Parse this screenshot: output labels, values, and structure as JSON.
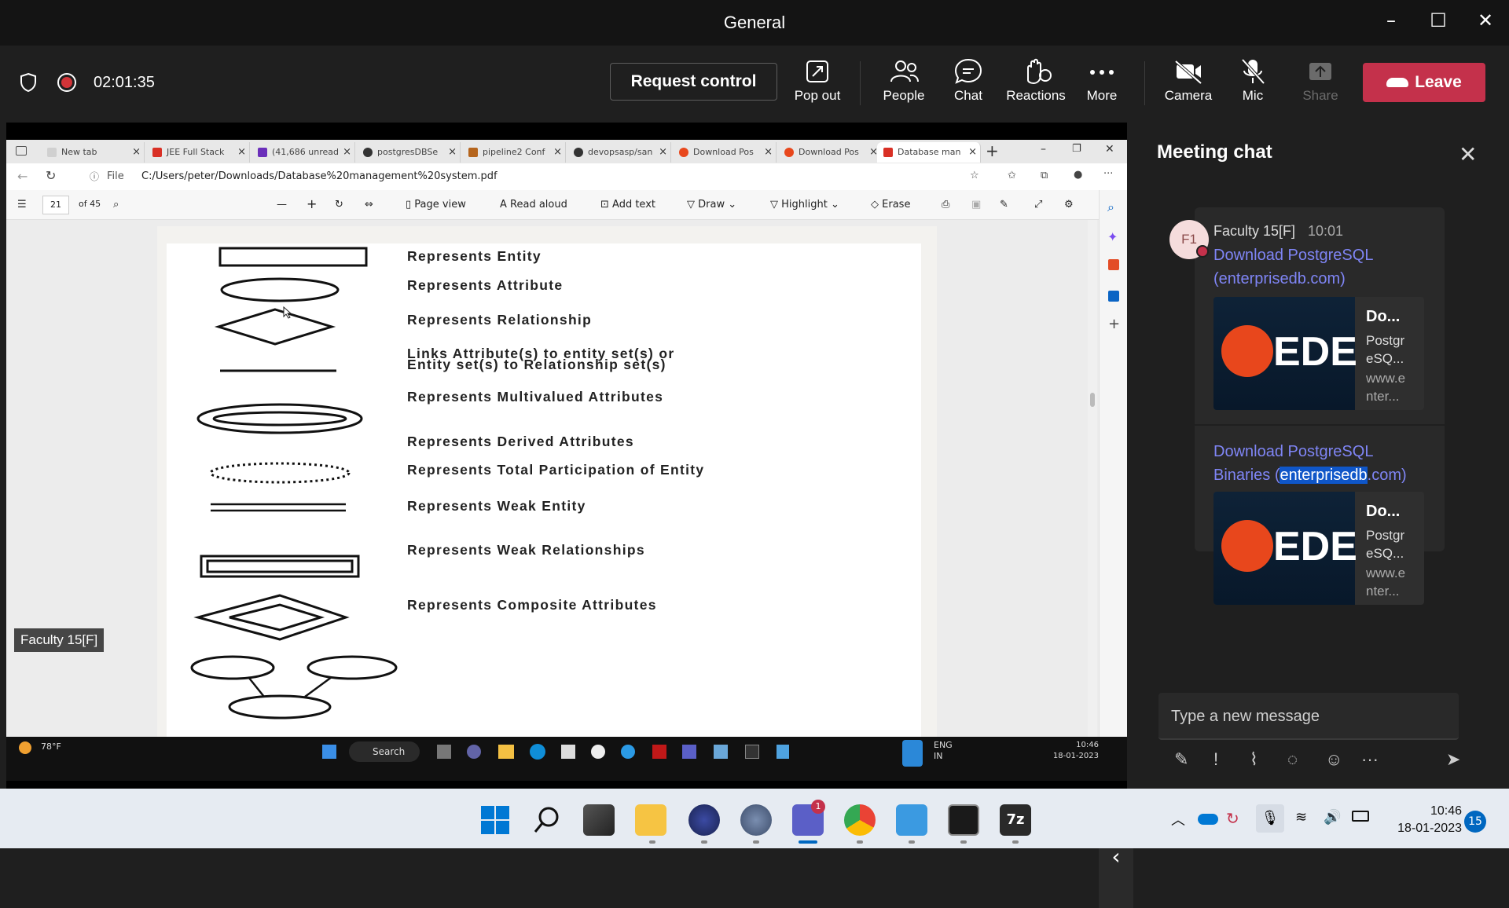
{
  "window": {
    "title": "General"
  },
  "meeting": {
    "timer": "02:01:35",
    "request_control": "Request control",
    "controls": {
      "popout": "Pop out",
      "people": "People",
      "chat": "Chat",
      "reactions": "Reactions",
      "more": "More",
      "camera": "Camera",
      "mic": "Mic",
      "share": "Share"
    },
    "leave": "Leave",
    "presenter_tag": "Faculty 15[F]"
  },
  "browser": {
    "tabs": [
      {
        "label": "New tab",
        "color": "#d0d0d0"
      },
      {
        "label": "JEE Full Stack",
        "color": "#d93025"
      },
      {
        "label": "(41,686 unread",
        "color": "#6b2fba"
      },
      {
        "label": "postgresDBSe",
        "color": "#333333"
      },
      {
        "label": "pipeline2 Conf",
        "color": "#b5651d"
      },
      {
        "label": "devopsasp/san",
        "color": "#333333"
      },
      {
        "label": "Download Pos",
        "color": "#e8471c"
      },
      {
        "label": "Download Pos",
        "color": "#e8471c"
      },
      {
        "label": "Database man",
        "color": "#d93025"
      }
    ],
    "address_prefix": "File",
    "address": "C:/Users/peter/Downloads/Database%20management%20system.pdf",
    "pdf_toolbar": {
      "page_current": "21",
      "page_total": "of 45",
      "page_view": "Page view",
      "read_aloud": "Read aloud",
      "add_text": "Add text",
      "draw": "Draw",
      "highlight": "Highlight",
      "erase": "Erase"
    },
    "pdf_rows": [
      "Represents Entity",
      "Represents Attribute",
      "Represents Relationship",
      "Links Attribute(s) to entity set(s) or",
      "Entity set(s) to Relationship set(s)",
      "Represents Multivalued Attributes",
      "Represents Derived Attributes",
      "Represents Total Participation of Entity",
      "Represents Weak Entity",
      "Represents Weak Relationships",
      "Represents Composite Attributes"
    ],
    "inner_taskbar": {
      "weather": "78°F",
      "search": "Search",
      "lang1": "ENG",
      "lang2": "IN",
      "time": "10:46",
      "date": "18-01-2023"
    }
  },
  "chat": {
    "title": "Meeting chat",
    "sender": "Faculty 15[F]",
    "initials": "F1",
    "time": "10:01",
    "message1_link": "Download PostgreSQL (enterprisedb.com)",
    "message2_link_a": "Download PostgreSQL Binaries (",
    "message2_link_sel": "enterprisedb",
    "message2_link_b": ".com)",
    "preview": {
      "logo_text": "EDE",
      "title": "Do...",
      "desc": "Postgr eSQ...",
      "url": "www.e nter..."
    },
    "compose_placeholder": "Type a new message"
  },
  "taskbar": {
    "time": "10:46",
    "date": "18-01-2023",
    "notifications": "15",
    "teams_badge": "1"
  }
}
